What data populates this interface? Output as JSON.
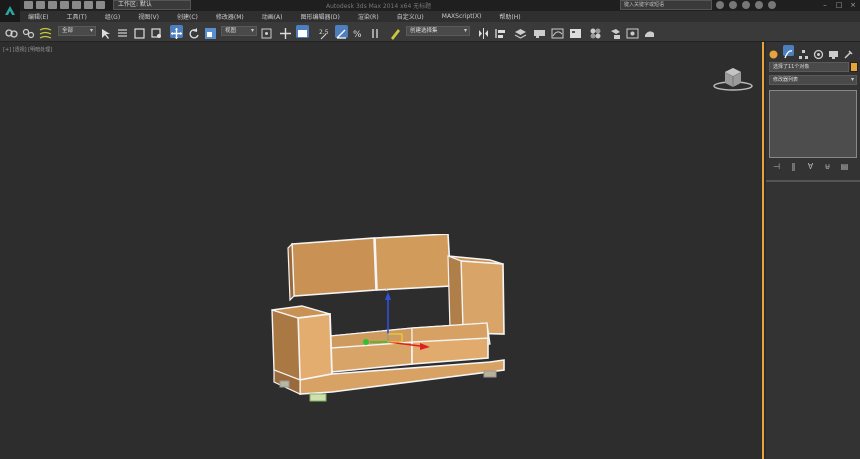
{
  "titlebar": {
    "workspace_label": "工作区: 默认",
    "title": "Autodesk 3ds Max 2014 x64    无标题",
    "search_placeholder": "键入关键字或短语"
  },
  "menu": {
    "items": [
      "编辑(E)",
      "工具(T)",
      "组(G)",
      "视图(V)",
      "创建(C)",
      "修改器(M)",
      "动画(A)",
      "图形编辑器(D)",
      "渲染(R)",
      "自定义(U)",
      "MAXScript(X)",
      "帮助(H)"
    ]
  },
  "toolbar": {
    "filter_dropdown": "全部",
    "refcoord_dropdown": "视图",
    "selection_set_dropdown": "创建选择集"
  },
  "viewport": {
    "label": "[+] [透视] [明暗处理]"
  },
  "command_panel": {
    "object_name": "选择了11个对象",
    "modifier_list": "修改器列表"
  },
  "colors": {
    "accent": "#e8a33a",
    "sofa": "#d49a5c"
  }
}
